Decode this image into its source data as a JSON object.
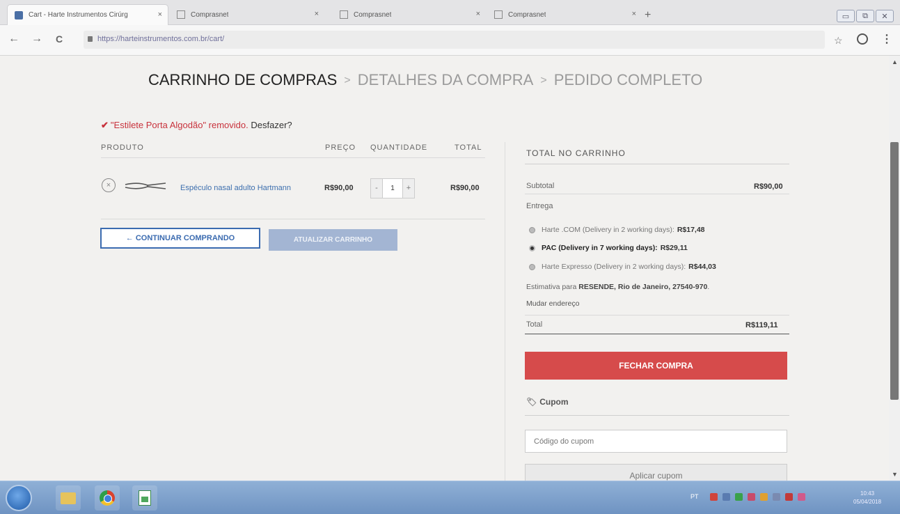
{
  "browser": {
    "tabs": [
      {
        "title": "Cart - Harte Instrumentos Cirúrg",
        "close": "×",
        "active": true
      },
      {
        "title": "Comprasnet",
        "close": "×",
        "active": false
      },
      {
        "title": "Comprasnet",
        "close": "×",
        "active": false
      },
      {
        "title": "Comprasnet",
        "close": "×",
        "active": false
      }
    ],
    "new_tab": "+",
    "window_controls": {
      "minimize": "▭",
      "restore": "⧉",
      "close": "✕"
    },
    "nav": {
      "back": "←",
      "forward": "→",
      "reload": "C"
    },
    "url": "https://harteinstrumentos.com.br/cart/",
    "star": "☆",
    "menu": "⋮"
  },
  "checkout_steps": {
    "step1": "CARRINHO DE COMPRAS",
    "sep1": ">",
    "step2": "DETALHES DA COMPRA",
    "sep2": ">",
    "step3": "PEDIDO COMPLETO"
  },
  "notice": {
    "check": "✔",
    "message": "\"Estilete Porta Algodão\" removido.",
    "undo": "Desfazer?"
  },
  "cart_table": {
    "headers": {
      "product": "PRODUTO",
      "price": "PREÇO",
      "quantity": "QUANTIDADE",
      "total": "TOTAL"
    },
    "items": [
      {
        "remove": "×",
        "name": "Espéculo nasal adulto Hartmann",
        "price": "R$90,00",
        "qty_minus": "-",
        "qty_value": "1",
        "qty_plus": "+",
        "total": "R$90,00"
      }
    ]
  },
  "actions": {
    "continue": "← CONTINUAR COMPRANDO",
    "update": "ATUALIZAR CARRINHO"
  },
  "totals": {
    "title": "TOTAL NO CARRINHO",
    "subtotal_label": "Subtotal",
    "subtotal_value": "R$90,00",
    "shipping_label": "Entrega",
    "shipping_options": [
      {
        "label": "Harte .COM (Delivery in 2 working days):",
        "price": "R$17,48",
        "selected": false
      },
      {
        "label": "PAC (Delivery in 7 working days):",
        "price": "R$29,11",
        "selected": true
      },
      {
        "label": "Harte Expresso (Delivery in 2 working days):",
        "price": "R$44,03",
        "selected": false
      }
    ],
    "estimate_prefix": "Estimativa para",
    "estimate_location": "RESENDE, Rio de Janeiro, 27540-970",
    "estimate_suffix": ".",
    "change_address": "Mudar endereço",
    "total_label": "Total",
    "total_value": "R$119,11",
    "checkout_button": "FECHAR COMPRA"
  },
  "coupon": {
    "icon": "🏷",
    "title": "Cupom",
    "placeholder": "Código do cupom",
    "apply": "Aplicar cupom"
  },
  "taskbar": {
    "lang": "PT",
    "time": "10:43",
    "date": "05/04/2018"
  },
  "colors": {
    "accent_red": "#d64b4b",
    "link_blue": "#3b6bb0",
    "notice_red": "#c8323c"
  }
}
